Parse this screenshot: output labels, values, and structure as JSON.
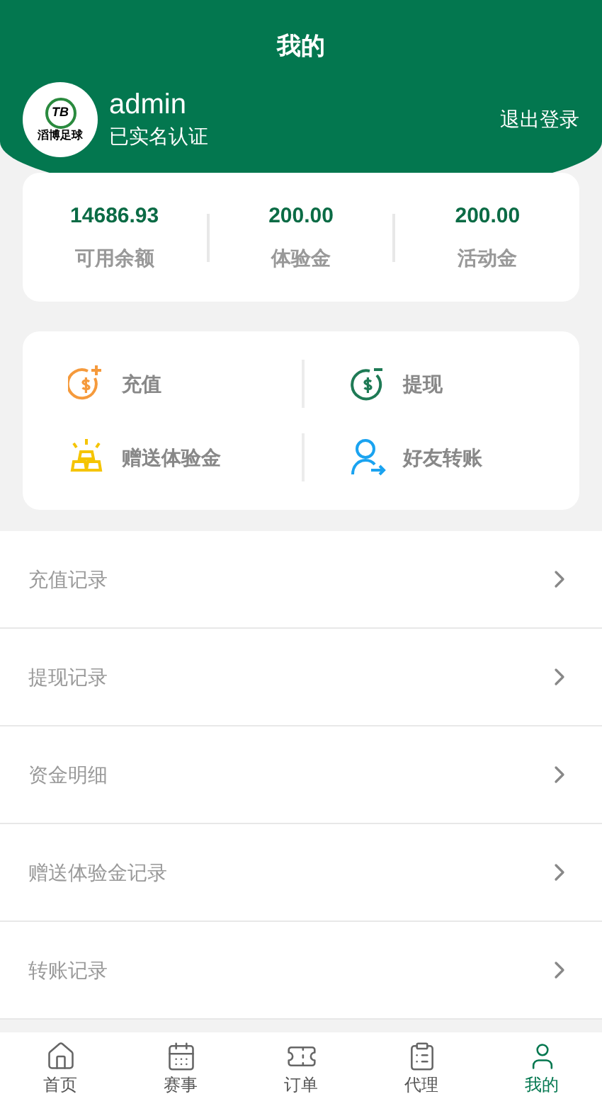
{
  "header": {
    "title": "我的",
    "logo": {
      "badge": "TB",
      "caption": "滔博足球"
    },
    "username": "admin",
    "verification": "已实名认证",
    "logout": "退出登录"
  },
  "balances": [
    {
      "value": "14686.93",
      "label": "可用余额"
    },
    {
      "value": "200.00",
      "label": "体验金"
    },
    {
      "value": "200.00",
      "label": "活动金"
    }
  ],
  "actions": [
    {
      "kind": "deposit",
      "label": "充值"
    },
    {
      "kind": "withdraw",
      "label": "提现"
    },
    {
      "kind": "gift",
      "label": "赠送体验金"
    },
    {
      "kind": "transfer",
      "label": "好友转账"
    }
  ],
  "records": [
    {
      "label": "充值记录"
    },
    {
      "label": "提现记录"
    },
    {
      "label": "资金明细"
    },
    {
      "label": "赠送体验金记录"
    },
    {
      "label": "转账记录"
    }
  ],
  "tabbar": [
    {
      "kind": "home",
      "label": "首页",
      "selected": false
    },
    {
      "kind": "events",
      "label": "赛事",
      "selected": false
    },
    {
      "kind": "orders",
      "label": "订单",
      "selected": false
    },
    {
      "kind": "agent",
      "label": "代理",
      "selected": false
    },
    {
      "kind": "me",
      "label": "我的",
      "selected": true
    }
  ]
}
